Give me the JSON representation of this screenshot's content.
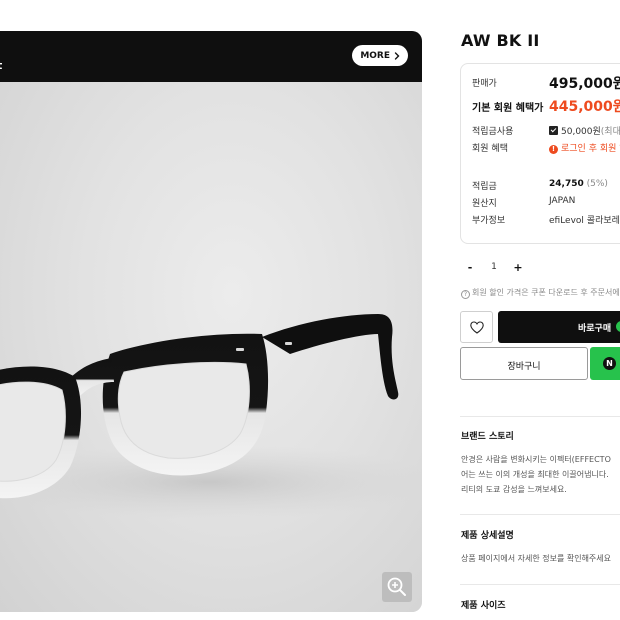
{
  "gallery": {
    "header_text": "t",
    "more_label": "MORE"
  },
  "product": {
    "name": "AW BK II"
  },
  "price_box": {
    "sale_price_label": "판매가",
    "sale_price": "495,000원",
    "member_price_label": "기본 회원 혜택가",
    "member_price": "445,000원",
    "points_use_label": "적립금사용",
    "points_use_value": "50,000원",
    "points_use_note": "(최대",
    "member_benefit_label": "회원 혜택",
    "member_benefit_value": "로그인 후 회원 혜",
    "reward_label": "적립금",
    "reward_value": "24,750",
    "reward_rate": "(5%)",
    "origin_label": "원산지",
    "origin_value": "JAPAN",
    "extra_label": "부가정보",
    "extra_value": "efiLevol 콜라보레이"
  },
  "quantity": {
    "minus": "-",
    "value": "1",
    "plus": "+"
  },
  "coupon_note": "회원 할인 가격은 쿠폰 다운로드 후 주문서에서",
  "actions": {
    "buy_label": "바로구매",
    "cart_label": "장바구니"
  },
  "sections": {
    "brand_story_title": "브랜드 스토리",
    "brand_story_lines": [
      "안경은 사람을 변화시키는 이펙터(EFFECTO",
      "어는 쓰는 이의 개성을 최대한 이끌어냅니다.",
      "리티의 도쿄 감성을 느껴보세요."
    ],
    "detail_title": "제품 상세설명",
    "detail_text": "상품 페이지에서 자세한 정보를 확인해주세요",
    "size_title": "제품 사이즈"
  }
}
